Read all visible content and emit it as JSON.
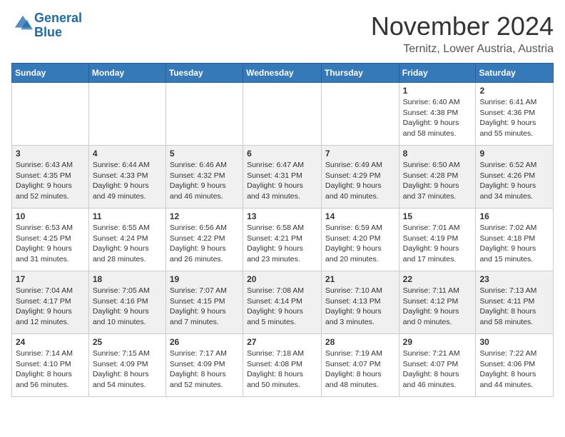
{
  "header": {
    "logo_line1": "General",
    "logo_line2": "Blue",
    "month_title": "November 2024",
    "location": "Ternitz, Lower Austria, Austria"
  },
  "weekdays": [
    "Sunday",
    "Monday",
    "Tuesday",
    "Wednesday",
    "Thursday",
    "Friday",
    "Saturday"
  ],
  "weeks": [
    [
      {
        "day": "",
        "info": ""
      },
      {
        "day": "",
        "info": ""
      },
      {
        "day": "",
        "info": ""
      },
      {
        "day": "",
        "info": ""
      },
      {
        "day": "",
        "info": ""
      },
      {
        "day": "1",
        "info": "Sunrise: 6:40 AM\nSunset: 4:38 PM\nDaylight: 9 hours\nand 58 minutes."
      },
      {
        "day": "2",
        "info": "Sunrise: 6:41 AM\nSunset: 4:36 PM\nDaylight: 9 hours\nand 55 minutes."
      }
    ],
    [
      {
        "day": "3",
        "info": "Sunrise: 6:43 AM\nSunset: 4:35 PM\nDaylight: 9 hours\nand 52 minutes."
      },
      {
        "day": "4",
        "info": "Sunrise: 6:44 AM\nSunset: 4:33 PM\nDaylight: 9 hours\nand 49 minutes."
      },
      {
        "day": "5",
        "info": "Sunrise: 6:46 AM\nSunset: 4:32 PM\nDaylight: 9 hours\nand 46 minutes."
      },
      {
        "day": "6",
        "info": "Sunrise: 6:47 AM\nSunset: 4:31 PM\nDaylight: 9 hours\nand 43 minutes."
      },
      {
        "day": "7",
        "info": "Sunrise: 6:49 AM\nSunset: 4:29 PM\nDaylight: 9 hours\nand 40 minutes."
      },
      {
        "day": "8",
        "info": "Sunrise: 6:50 AM\nSunset: 4:28 PM\nDaylight: 9 hours\nand 37 minutes."
      },
      {
        "day": "9",
        "info": "Sunrise: 6:52 AM\nSunset: 4:26 PM\nDaylight: 9 hours\nand 34 minutes."
      }
    ],
    [
      {
        "day": "10",
        "info": "Sunrise: 6:53 AM\nSunset: 4:25 PM\nDaylight: 9 hours\nand 31 minutes."
      },
      {
        "day": "11",
        "info": "Sunrise: 6:55 AM\nSunset: 4:24 PM\nDaylight: 9 hours\nand 28 minutes."
      },
      {
        "day": "12",
        "info": "Sunrise: 6:56 AM\nSunset: 4:22 PM\nDaylight: 9 hours\nand 26 minutes."
      },
      {
        "day": "13",
        "info": "Sunrise: 6:58 AM\nSunset: 4:21 PM\nDaylight: 9 hours\nand 23 minutes."
      },
      {
        "day": "14",
        "info": "Sunrise: 6:59 AM\nSunset: 4:20 PM\nDaylight: 9 hours\nand 20 minutes."
      },
      {
        "day": "15",
        "info": "Sunrise: 7:01 AM\nSunset: 4:19 PM\nDaylight: 9 hours\nand 17 minutes."
      },
      {
        "day": "16",
        "info": "Sunrise: 7:02 AM\nSunset: 4:18 PM\nDaylight: 9 hours\nand 15 minutes."
      }
    ],
    [
      {
        "day": "17",
        "info": "Sunrise: 7:04 AM\nSunset: 4:17 PM\nDaylight: 9 hours\nand 12 minutes."
      },
      {
        "day": "18",
        "info": "Sunrise: 7:05 AM\nSunset: 4:16 PM\nDaylight: 9 hours\nand 10 minutes."
      },
      {
        "day": "19",
        "info": "Sunrise: 7:07 AM\nSunset: 4:15 PM\nDaylight: 9 hours\nand 7 minutes."
      },
      {
        "day": "20",
        "info": "Sunrise: 7:08 AM\nSunset: 4:14 PM\nDaylight: 9 hours\nand 5 minutes."
      },
      {
        "day": "21",
        "info": "Sunrise: 7:10 AM\nSunset: 4:13 PM\nDaylight: 9 hours\nand 3 minutes."
      },
      {
        "day": "22",
        "info": "Sunrise: 7:11 AM\nSunset: 4:12 PM\nDaylight: 9 hours\nand 0 minutes."
      },
      {
        "day": "23",
        "info": "Sunrise: 7:13 AM\nSunset: 4:11 PM\nDaylight: 8 hours\nand 58 minutes."
      }
    ],
    [
      {
        "day": "24",
        "info": "Sunrise: 7:14 AM\nSunset: 4:10 PM\nDaylight: 8 hours\nand 56 minutes."
      },
      {
        "day": "25",
        "info": "Sunrise: 7:15 AM\nSunset: 4:09 PM\nDaylight: 8 hours\nand 54 minutes."
      },
      {
        "day": "26",
        "info": "Sunrise: 7:17 AM\nSunset: 4:09 PM\nDaylight: 8 hours\nand 52 minutes."
      },
      {
        "day": "27",
        "info": "Sunrise: 7:18 AM\nSunset: 4:08 PM\nDaylight: 8 hours\nand 50 minutes."
      },
      {
        "day": "28",
        "info": "Sunrise: 7:19 AM\nSunset: 4:07 PM\nDaylight: 8 hours\nand 48 minutes."
      },
      {
        "day": "29",
        "info": "Sunrise: 7:21 AM\nSunset: 4:07 PM\nDaylight: 8 hours\nand 46 minutes."
      },
      {
        "day": "30",
        "info": "Sunrise: 7:22 AM\nSunset: 4:06 PM\nDaylight: 8 hours\nand 44 minutes."
      }
    ]
  ]
}
